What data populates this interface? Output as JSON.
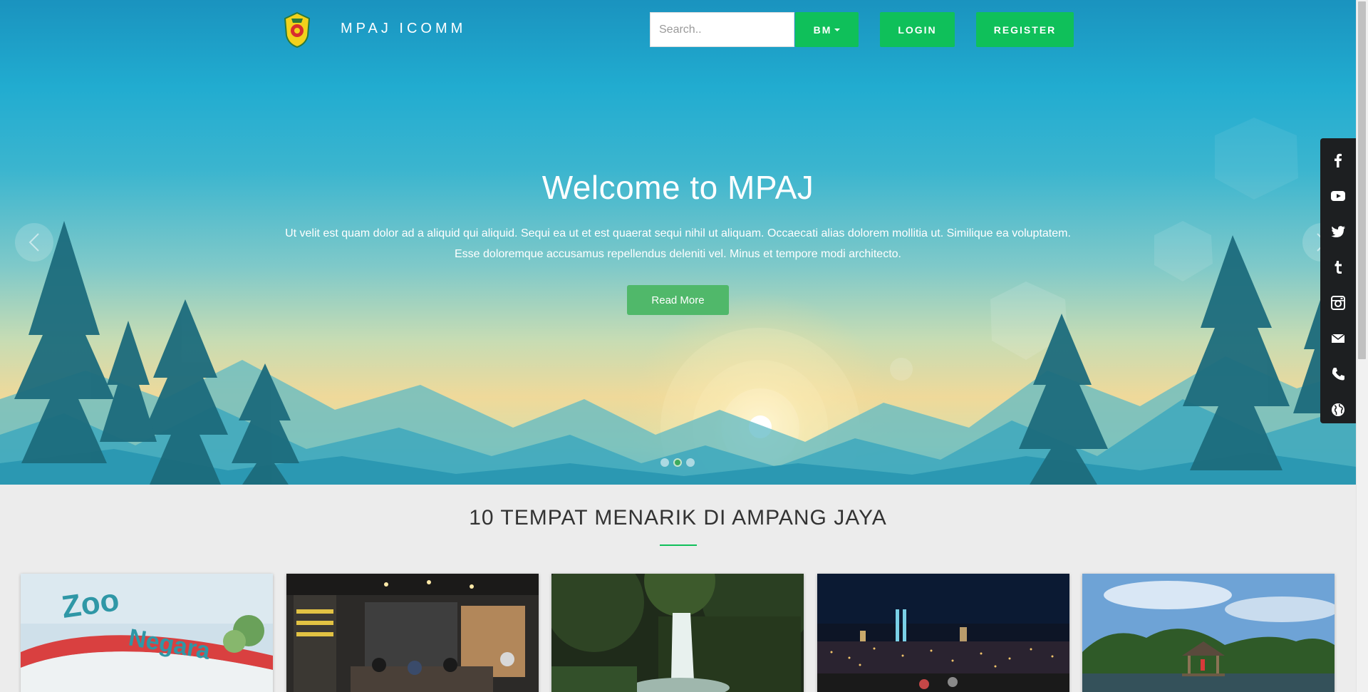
{
  "header": {
    "brand_name": "MPAJ ICOMM",
    "logo": "mpaj-crest",
    "search_placeholder": "Search..",
    "language_label": "BM",
    "login_label": "LOGIN",
    "register_label": "REGISTER"
  },
  "hero": {
    "title": "Welcome to MPAJ",
    "description": "Ut velit est quam dolor ad a aliquid qui aliquid. Sequi ea ut et est quaerat sequi nihil ut aliquam. Occaecati alias dolorem mollitia ut. Similique ea voluptatem. Esse doloremque accusamus repellendus deleniti vel. Minus et tempore modi architecto.",
    "button_label": "Read More",
    "slide_count": 3,
    "active_slide": 2,
    "prev_icon": "chevron-left-icon",
    "next_icon": "chevron-right-icon"
  },
  "social": {
    "items": [
      "facebook-icon",
      "youtube-icon",
      "twitter-icon",
      "tumblr-icon",
      "instagram-icon",
      "email-icon",
      "phone-icon",
      "globe-icon"
    ]
  },
  "section": {
    "title": "10 TEMPAT MENARIK DI AMPANG JAYA",
    "cards": [
      "zoo-negara-photo",
      "cafe-interior-photo",
      "waterfall-photo",
      "city-night-view-photo",
      "lake-gazebo-photo"
    ]
  },
  "colors": {
    "accent_green": "#0fc05a",
    "read_more_green": "#50b86a",
    "social_bar": "#1d1f21"
  }
}
